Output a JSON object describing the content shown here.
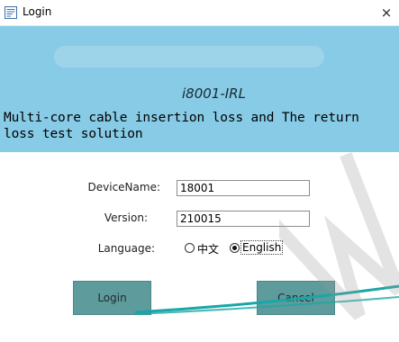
{
  "window": {
    "title": "Login",
    "close_glyph": "×",
    "icon": "app-form-icon"
  },
  "banner": {
    "product_name": "i8001-IRL",
    "description": "Multi-core cable insertion loss and The return loss test solution"
  },
  "form": {
    "device_name_label": "DeviceName:",
    "device_name_value": "18001",
    "version_label": "Version:",
    "version_value": "210015",
    "language_label": "Language:",
    "language_options": [
      {
        "label": "中文",
        "selected": false
      },
      {
        "label": "English",
        "selected": true
      }
    ]
  },
  "buttons": {
    "login_label": "Login",
    "cancel_label": "Cancel"
  },
  "colors": {
    "banner": "#87cbe6",
    "button": "#5e9b9c",
    "cable": "#1aa6a6"
  }
}
